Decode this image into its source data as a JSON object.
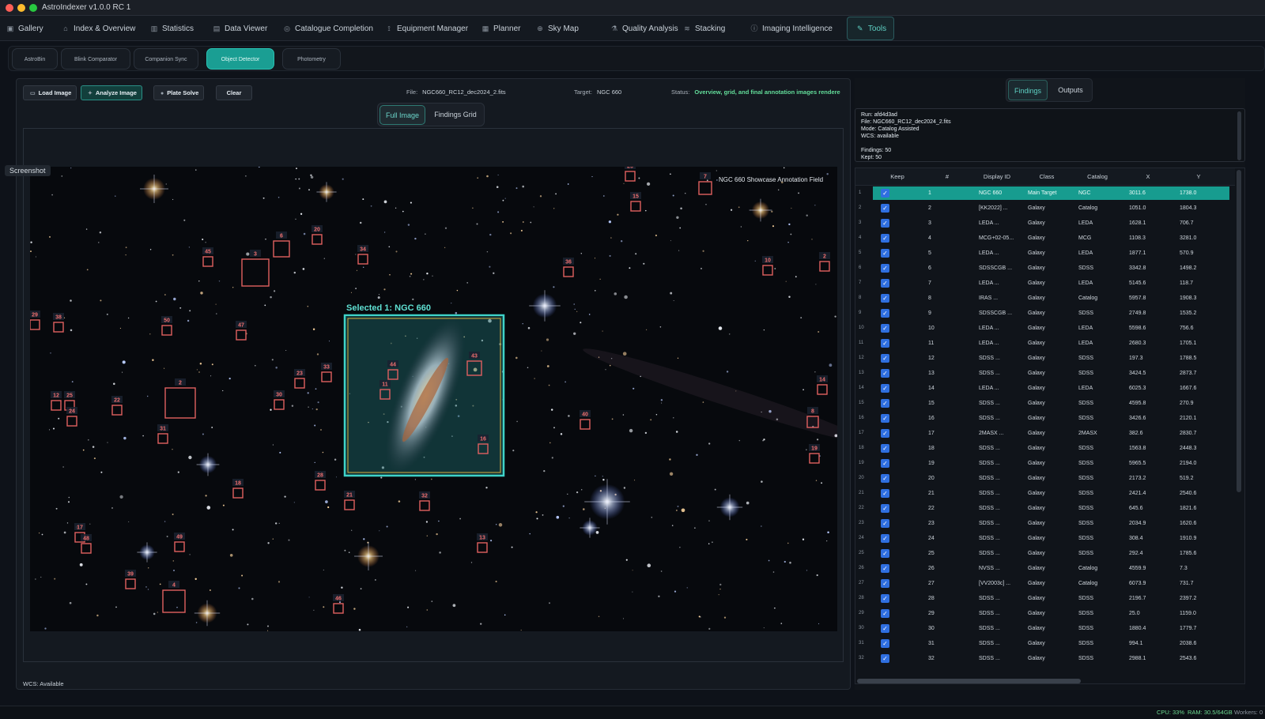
{
  "window": {
    "title": "AstroIndexer v1.0.0 RC 1"
  },
  "main_tabs": [
    {
      "label": "Gallery",
      "icon": "image-icon"
    },
    {
      "label": "Index & Overview",
      "icon": "home-icon"
    },
    {
      "label": "Statistics",
      "icon": "bar-chart-icon"
    },
    {
      "label": "Data Viewer",
      "icon": "document-icon"
    },
    {
      "label": "Catalogue Completion",
      "icon": "target-icon"
    },
    {
      "label": "Equipment Manager",
      "icon": "telescope-icon"
    },
    {
      "label": "Planner",
      "icon": "calendar-icon"
    },
    {
      "label": "Sky Map",
      "icon": "globe-icon"
    },
    {
      "label": "Quality Analysis",
      "icon": "flask-icon"
    },
    {
      "label": "Stacking",
      "icon": "layers-icon"
    },
    {
      "label": "Imaging Intelligence",
      "icon": "info-icon"
    },
    {
      "label": "Tools",
      "icon": "wrench-icon",
      "active": true
    }
  ],
  "sub_tabs": [
    "AstroBin",
    "Blink Comparator",
    "Companion Sync",
    "Object Detector",
    "Photometry"
  ],
  "toolbar": {
    "load": "Load Image",
    "analyze": "Analyze Image",
    "plate": "Plate Solve",
    "clear": "Clear",
    "file_label": "File:",
    "file_value": "NGC660_RC12_dec2024_2.fits",
    "target_label": "Target:",
    "target_value": "NGC 660",
    "status_label": "Status:",
    "status_value": "Overview, grid, and final annotation images rendere"
  },
  "view_toggle": {
    "full": "Full Image",
    "grid": "Findings Grid"
  },
  "image": {
    "banner": "NGC 660 Showcase Annotation Field",
    "selected_label": "Selected 1: NGC  660",
    "markers": [
      {
        "n": "26"
      },
      {
        "n": "7"
      },
      {
        "n": "15"
      },
      {
        "n": "20"
      },
      {
        "n": "6"
      },
      {
        "n": "45"
      },
      {
        "n": "3"
      },
      {
        "n": "34"
      },
      {
        "n": "36"
      },
      {
        "n": "10"
      },
      {
        "n": "2"
      },
      {
        "n": "29"
      },
      {
        "n": "38"
      },
      {
        "n": "50"
      },
      {
        "n": "47"
      },
      {
        "n": "44"
      },
      {
        "n": "43"
      },
      {
        "n": "11"
      },
      {
        "n": "33"
      },
      {
        "n": "23"
      },
      {
        "n": "30"
      },
      {
        "n": "12"
      },
      {
        "n": "25"
      },
      {
        "n": "24"
      },
      {
        "n": "22"
      },
      {
        "n": "2"
      },
      {
        "n": "31"
      },
      {
        "n": "16"
      },
      {
        "n": "40"
      },
      {
        "n": "14"
      },
      {
        "n": "8"
      },
      {
        "n": "19"
      },
      {
        "n": "28"
      },
      {
        "n": "18"
      },
      {
        "n": "21"
      },
      {
        "n": "32"
      },
      {
        "n": "17"
      },
      {
        "n": "48"
      },
      {
        "n": "49"
      },
      {
        "n": "13"
      },
      {
        "n": "39"
      },
      {
        "n": "4"
      },
      {
        "n": "46"
      }
    ]
  },
  "tooltip": "Screenshot",
  "wcs_status": "WCS: Available",
  "right_tabs": {
    "findings": "Findings",
    "outputs": "Outputs"
  },
  "summary": {
    "run": "Run: afd4d3ad",
    "file": "File: NGC660_RC12_dec2024_2.fits",
    "mode": "Mode: Catalog Assisted",
    "wcs": "WCS: available",
    "findings": "Findings: 50",
    "kept": "Kept: 50"
  },
  "table": {
    "headers": [
      "Keep",
      "#",
      "Display ID",
      "Class",
      "Catalog",
      "X",
      "Y"
    ],
    "rows": [
      [
        "1",
        "NGC   660",
        "Main Target",
        "NGC",
        "3011.6",
        "1738.0"
      ],
      [
        "2",
        "[KK2022] ...",
        "Galaxy",
        "Catalog",
        "1051.0",
        "1804.3"
      ],
      [
        "3",
        "LEDA ...",
        "Galaxy",
        "LEDA",
        "1628.1",
        "706.7"
      ],
      [
        "4",
        "MCG+02-05...",
        "Galaxy",
        "MCG",
        "1108.3",
        "3281.0"
      ],
      [
        "5",
        "LEDA ...",
        "Galaxy",
        "LEDA",
        "1877.1",
        "570.9"
      ],
      [
        "6",
        "SDSSCGB ...",
        "Galaxy",
        "SDSS",
        "3342.8",
        "1498.2"
      ],
      [
        "7",
        "LEDA ...",
        "Galaxy",
        "LEDA",
        "5145.6",
        "118.7"
      ],
      [
        "8",
        "IRAS ...",
        "Galaxy",
        "Catalog",
        "5957.8",
        "1908.3"
      ],
      [
        "9",
        "SDSSCGB ...",
        "Galaxy",
        "SDSS",
        "2749.8",
        "1535.2"
      ],
      [
        "10",
        "LEDA ...",
        "Galaxy",
        "LEDA",
        "5598.6",
        "756.6"
      ],
      [
        "11",
        "LEDA ...",
        "Galaxy",
        "LEDA",
        "2680.3",
        "1705.1"
      ],
      [
        "12",
        "SDSS ...",
        "Galaxy",
        "SDSS",
        "197.3",
        "1788.5"
      ],
      [
        "13",
        "SDSS ...",
        "Galaxy",
        "SDSS",
        "3424.5",
        "2873.7"
      ],
      [
        "14",
        "LEDA ...",
        "Galaxy",
        "LEDA",
        "6025.3",
        "1667.6"
      ],
      [
        "15",
        "SDSS ...",
        "Galaxy",
        "SDSS",
        "4595.8",
        "270.9"
      ],
      [
        "16",
        "SDSS ...",
        "Galaxy",
        "SDSS",
        "3426.6",
        "2120.1"
      ],
      [
        "17",
        "2MASX ...",
        "Galaxy",
        "2MASX",
        "382.6",
        "2830.7"
      ],
      [
        "18",
        "SDSS ...",
        "Galaxy",
        "SDSS",
        "1563.8",
        "2448.3"
      ],
      [
        "19",
        "SDSS ...",
        "Galaxy",
        "SDSS",
        "5965.5",
        "2194.0"
      ],
      [
        "20",
        "SDSS ...",
        "Galaxy",
        "SDSS",
        "2173.2",
        "519.2"
      ],
      [
        "21",
        "SDSS ...",
        "Galaxy",
        "SDSS",
        "2421.4",
        "2540.6"
      ],
      [
        "22",
        "SDSS ...",
        "Galaxy",
        "SDSS",
        "645.6",
        "1821.6"
      ],
      [
        "23",
        "SDSS ...",
        "Galaxy",
        "SDSS",
        "2034.9",
        "1620.6"
      ],
      [
        "24",
        "SDSS ...",
        "Galaxy",
        "SDSS",
        "308.4",
        "1910.9"
      ],
      [
        "25",
        "SDSS ...",
        "Galaxy",
        "SDSS",
        "292.4",
        "1785.6"
      ],
      [
        "26",
        "NVSS ...",
        "Galaxy",
        "Catalog",
        "4559.9",
        "7.3"
      ],
      [
        "27",
        "[VV2003c] ...",
        "Galaxy",
        "Catalog",
        "6073.9",
        "731.7"
      ],
      [
        "28",
        "SDSS ...",
        "Galaxy",
        "SDSS",
        "2196.7",
        "2397.2"
      ],
      [
        "29",
        "SDSS ...",
        "Galaxy",
        "SDSS",
        "25.0",
        "1159.0"
      ],
      [
        "30",
        "SDSS ...",
        "Galaxy",
        "SDSS",
        "1880.4",
        "1779.7"
      ],
      [
        "31",
        "SDSS ...",
        "Galaxy",
        "SDSS",
        "994.1",
        "2038.6"
      ],
      [
        "32",
        "SDSS ...",
        "Galaxy",
        "SDSS",
        "2988.1",
        "2543.6"
      ]
    ]
  },
  "footer": {
    "cpu": "CPU: 33%",
    "ram": "RAM: 30.5/64GB",
    "workers": "Workers: 0"
  },
  "colors": {
    "accent": "#1a9e93",
    "marker": "#e06060",
    "status": "#63dd9a"
  }
}
